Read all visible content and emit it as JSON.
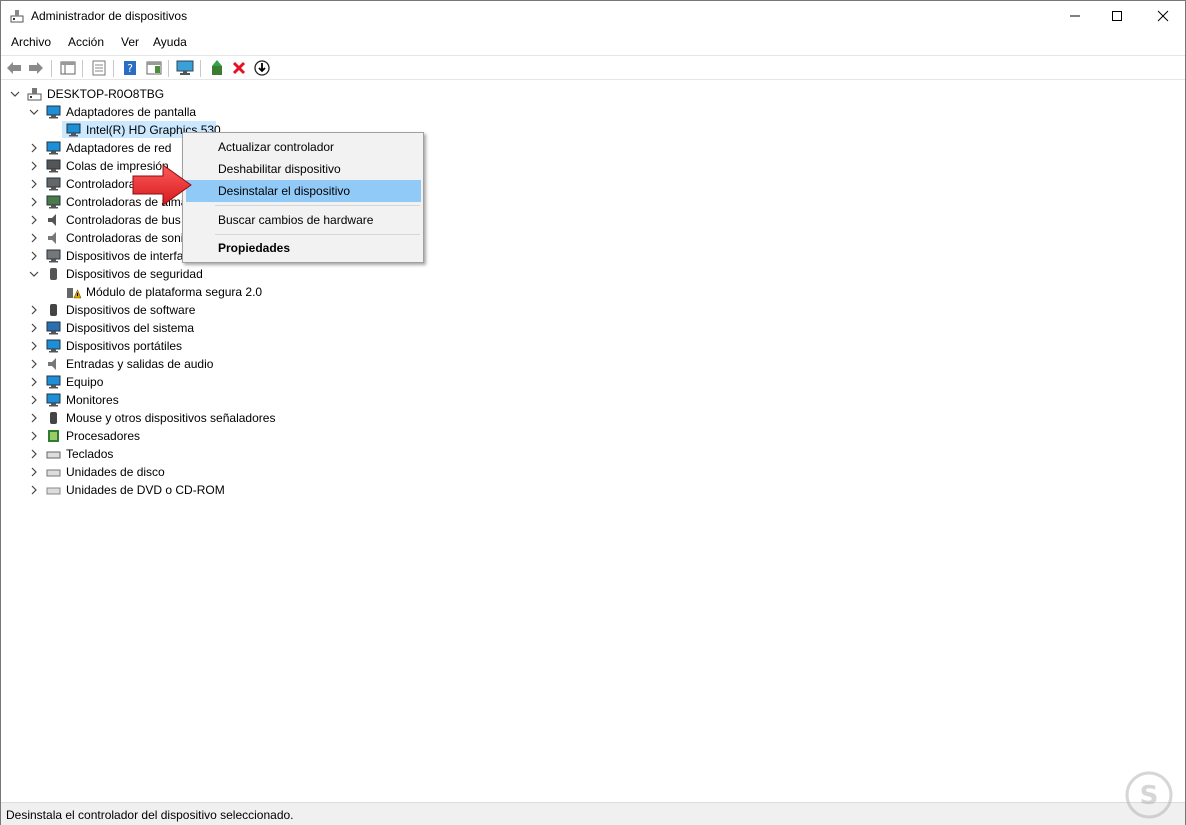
{
  "window": {
    "title": "Administrador de dispositivos",
    "minimize_glyph": "—",
    "maximize_glyph": "☐",
    "close_glyph": "✕"
  },
  "menubar": [
    "Archivo",
    "Acción",
    "Ver",
    "Ayuda"
  ],
  "toolbar": {
    "icons": [
      "back-arrow-icon",
      "forward-arrow-icon",
      "show-hide-console-tree-icon",
      "properties-icon",
      "help-icon",
      "action-pane-icon",
      "monitor-icon",
      "update-driver-icon",
      "uninstall-x-icon",
      "download-driver-icon"
    ]
  },
  "tree": {
    "root": "DESKTOP-R0O8TBG",
    "items": [
      {
        "label": "Adaptadores de pantalla",
        "expanded": true,
        "icon": "display-adapter-icon"
      },
      {
        "label": "Intel(R) HD Graphics 530",
        "child": true,
        "selected": true,
        "icon": "display-adapter-icon"
      },
      {
        "label": "Adaptadores de red",
        "icon": "network-adapter-icon"
      },
      {
        "label": "Colas de impresión",
        "icon": "print-queue-icon"
      },
      {
        "label": "Controladoras",
        "icon": "controller-icon"
      },
      {
        "label": "Controladoras de alma",
        "icon": "storage-controller-icon"
      },
      {
        "label": "Controladoras de bus",
        "icon": "usb-bus-icon"
      },
      {
        "label": "Controladoras de soni",
        "icon": "sound-controller-icon"
      },
      {
        "label": "Dispositivos de interfa",
        "icon": "hid-device-icon"
      },
      {
        "label": "Dispositivos de seguridad",
        "expanded": true,
        "icon": "security-device-icon"
      },
      {
        "label": "Módulo de plataforma segura 2.0",
        "child": true,
        "icon": "tpm-warning-icon"
      },
      {
        "label": "Dispositivos de software",
        "icon": "software-device-icon"
      },
      {
        "label": "Dispositivos del sistema",
        "icon": "system-device-icon"
      },
      {
        "label": "Dispositivos portátiles",
        "icon": "portable-device-icon"
      },
      {
        "label": "Entradas y salidas de audio",
        "icon": "audio-io-icon"
      },
      {
        "label": "Equipo",
        "icon": "computer-icon"
      },
      {
        "label": "Monitores",
        "icon": "monitor-icon"
      },
      {
        "label": "Mouse y otros dispositivos señaladores",
        "icon": "mouse-icon"
      },
      {
        "label": "Procesadores",
        "icon": "processor-icon"
      },
      {
        "label": "Teclados",
        "icon": "keyboard-icon"
      },
      {
        "label": "Unidades de disco",
        "icon": "disk-drive-icon"
      },
      {
        "label": "Unidades de DVD o CD-ROM",
        "icon": "dvd-drive-icon"
      }
    ]
  },
  "context_menu": {
    "items": [
      "Actualizar controlador",
      "Deshabilitar dispositivo",
      "Desinstalar el dispositivo",
      "Buscar cambios de hardware",
      "Propiedades"
    ],
    "highlighted": "Desinstalar el dispositivo",
    "highlight_color": "#91c9f7"
  },
  "statusbar": {
    "text": "Desinstala el controlador del dispositivo seleccionado."
  },
  "colors": {
    "selection": "#cce8ff",
    "arrow": "#e8262d"
  }
}
